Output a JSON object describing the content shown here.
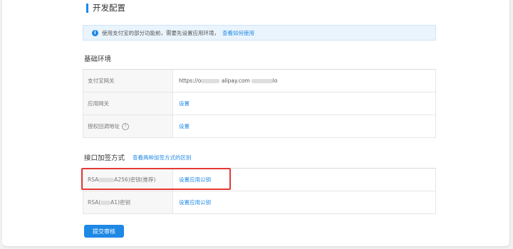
{
  "page": {
    "title": "开发配置"
  },
  "notice": {
    "text": "使用支付宝的部分功能前，需要先设置应用环境，",
    "link": "查看如何使用"
  },
  "basic_env": {
    "title": "基础环境",
    "rows": [
      {
        "key": "支付宝网关",
        "value_prefix": "https://o",
        "value_mid": " alipay.com",
        "value_suffix": "lo",
        "action": ""
      },
      {
        "key": "应用网关",
        "action": "设置"
      },
      {
        "key": "授权回调地址",
        "help_icon": "?",
        "action": "设置"
      }
    ]
  },
  "sign_method": {
    "title": "接口加签方式",
    "link": "查看两种加签方式的区别",
    "rows": [
      {
        "key_prefix": "RSA",
        "key_suffix": "A256)密钥(推荐)",
        "action": "设置应用公钥"
      },
      {
        "key_prefix": "RSA(",
        "key_suffix": "A1)密钥",
        "action": "设置应用公钥"
      }
    ]
  },
  "submit": {
    "label": "提交审核"
  },
  "colors": {
    "accent": "#1e88e5",
    "highlight": "#e53935"
  }
}
